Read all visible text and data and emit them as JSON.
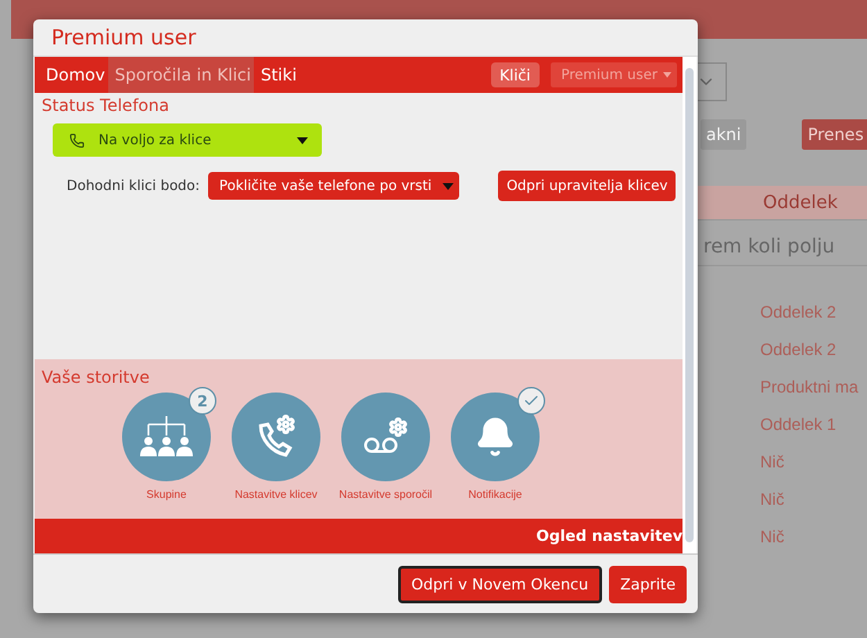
{
  "background": {
    "buttons": [
      "akni",
      "Prenes"
    ],
    "column_header": "Oddelek",
    "filter_placeholder": "rem koli polju",
    "rows": [
      "Oddelek 2",
      "Oddelek 2",
      "Produktni ma",
      "Oddelek 1",
      "Nič",
      "Nič",
      "Nič"
    ]
  },
  "modal": {
    "title": "Premium user",
    "nav": [
      {
        "label": "Domov",
        "selected": false
      },
      {
        "label": "Sporočila in Klici",
        "selected": true
      },
      {
        "label": "Stiki",
        "selected": false
      }
    ],
    "call_button": "Kliči",
    "user_menu": "Premium user",
    "status_heading": "Status Telefona",
    "status": "Na voljo za klice",
    "incoming_label": "Dohodni klici bodo:",
    "incoming_value": "Pokličite vaše telefone po vrsti",
    "manager_button": "Odpri upravitelja klicev",
    "services_heading": "Vaše storitve",
    "services": [
      {
        "kind": "groups",
        "label": "Skupine",
        "badge": "2"
      },
      {
        "kind": "call-settings",
        "label": "Nastavitve klicev"
      },
      {
        "kind": "message-settings",
        "label": "Nastavitve sporočil"
      },
      {
        "kind": "notifications",
        "label": "Notifikacije",
        "checked": true
      }
    ],
    "footer_bar": "Ogled nastavitev",
    "buttons": [
      {
        "label": "Odpri v Novem Okencu",
        "focused": true
      },
      {
        "label": "Zaprite",
        "focused": false
      }
    ]
  }
}
